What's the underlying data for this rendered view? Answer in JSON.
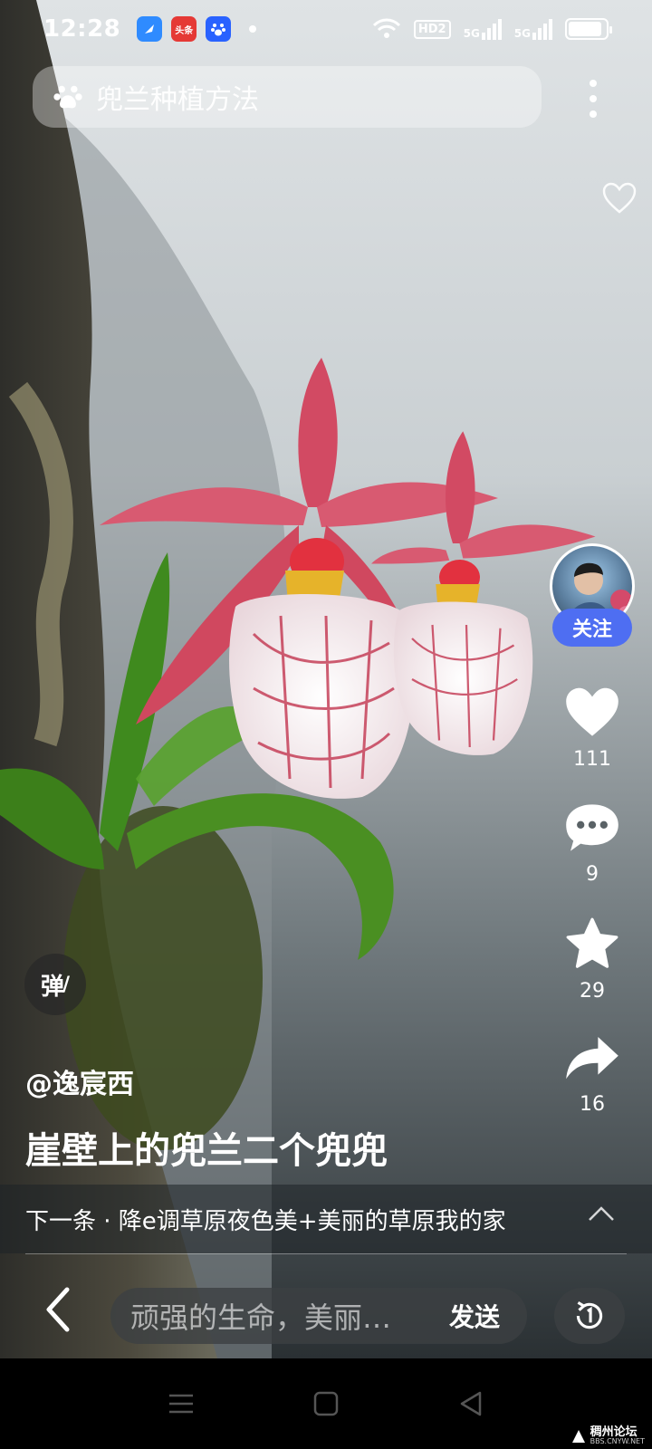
{
  "status_bar": {
    "time": "12:28",
    "app_icons": [
      "qq-browser-icon",
      "toutiao-icon",
      "baidu-icon"
    ],
    "toutiao_label": "头条",
    "hd_label": "HD2",
    "net1": "5G",
    "net2": "5G",
    "battery_level": 0.9
  },
  "search": {
    "query": "兜兰种植方法"
  },
  "actions": {
    "follow_label": "关注",
    "like_count": "111",
    "comment_count": "9",
    "favorite_count": "29",
    "share_count": "16"
  },
  "danmu": {
    "label": "弹"
  },
  "video": {
    "author": "@逸宸西",
    "caption": "崖壁上的兜兰二个兜兜"
  },
  "next": {
    "text": "下一条 · 降e调草原夜色美+美丽的草原我的家"
  },
  "comment": {
    "placeholder": "顽强的生命，美丽…",
    "send_label": "发送"
  },
  "watermark": {
    "main": "稠州论坛",
    "sub": "BBS.CNYW.NET"
  }
}
